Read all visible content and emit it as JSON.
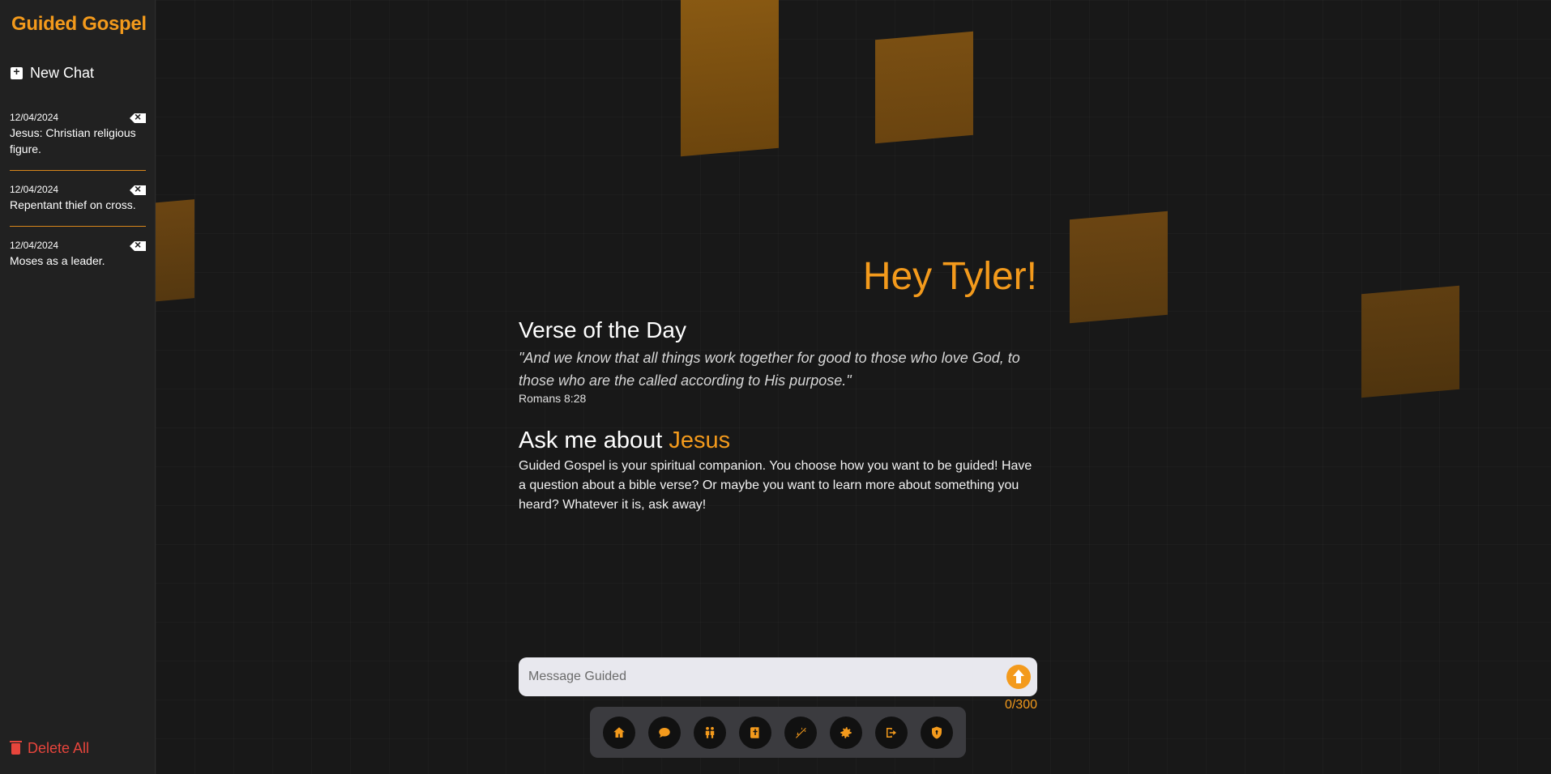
{
  "sidebar": {
    "brand": "Guided Gospel",
    "new_chat_label": "New Chat",
    "chats": [
      {
        "date": "12/04/2024",
        "title": "Jesus: Christian religious figure."
      },
      {
        "date": "12/04/2024",
        "title": "Repentant thief on cross."
      },
      {
        "date": "12/04/2024",
        "title": "Moses as a leader."
      }
    ],
    "delete_all_label": "Delete All"
  },
  "main": {
    "greeting": "Hey Tyler!",
    "verse_title": "Verse of the Day",
    "verse_text": "\"And we know that all things work together for good to those who love God, to those who are the called according to His purpose.\"",
    "verse_reference": "Romans 8:28",
    "ask_prefix": "Ask me about",
    "ask_topic": "Jesus",
    "description": "Guided Gospel is your spiritual companion. You choose how you want to be guided! Have a question about a bible verse? Or maybe you want to learn more about something you heard? Whatever it is, ask away!",
    "message_placeholder": "Message Guided",
    "char_counter": "0/300"
  },
  "nav": {
    "items": [
      "home-icon",
      "chat-bubble-icon",
      "people-icon",
      "bible-icon",
      "prayer-icon",
      "gear-icon",
      "logout-icon",
      "shield-icon"
    ]
  },
  "colors": {
    "accent": "#f39a1c",
    "danger": "#e8453c",
    "background": "#181818",
    "sidebar": "#212121"
  }
}
